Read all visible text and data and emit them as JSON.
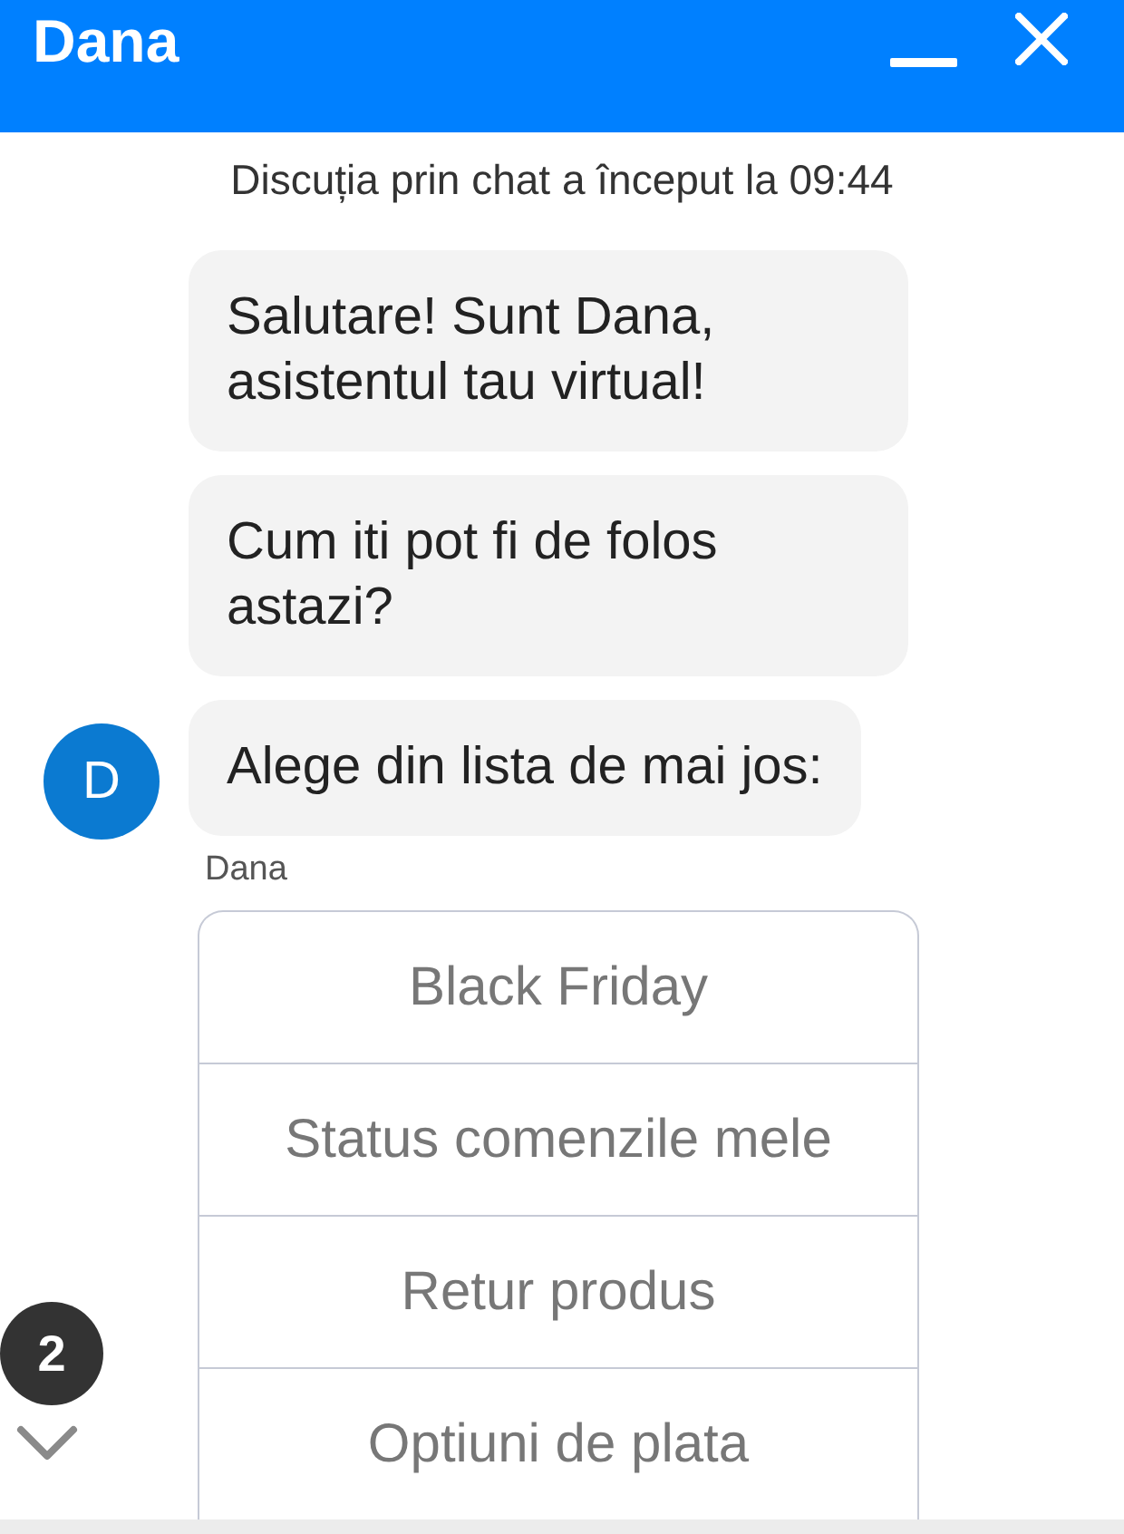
{
  "header": {
    "title": "Dana"
  },
  "chat": {
    "started_notice": "Discuția prin chat a început la 09:44",
    "messages": [
      {
        "text": "Salutare! Sunt Dana, asistentul tau virtual!"
      },
      {
        "text": "Cum iti pot fi de folos astazi?"
      },
      {
        "text": "Alege din lista de mai jos:"
      }
    ],
    "avatar": {
      "initial": "D"
    },
    "sender": "Dana",
    "quick_replies": [
      "Black Friday",
      "Status comenzile mele",
      "Retur produs",
      "Optiuni de plata"
    ]
  },
  "scroll_button": {
    "unread_count": "2"
  }
}
